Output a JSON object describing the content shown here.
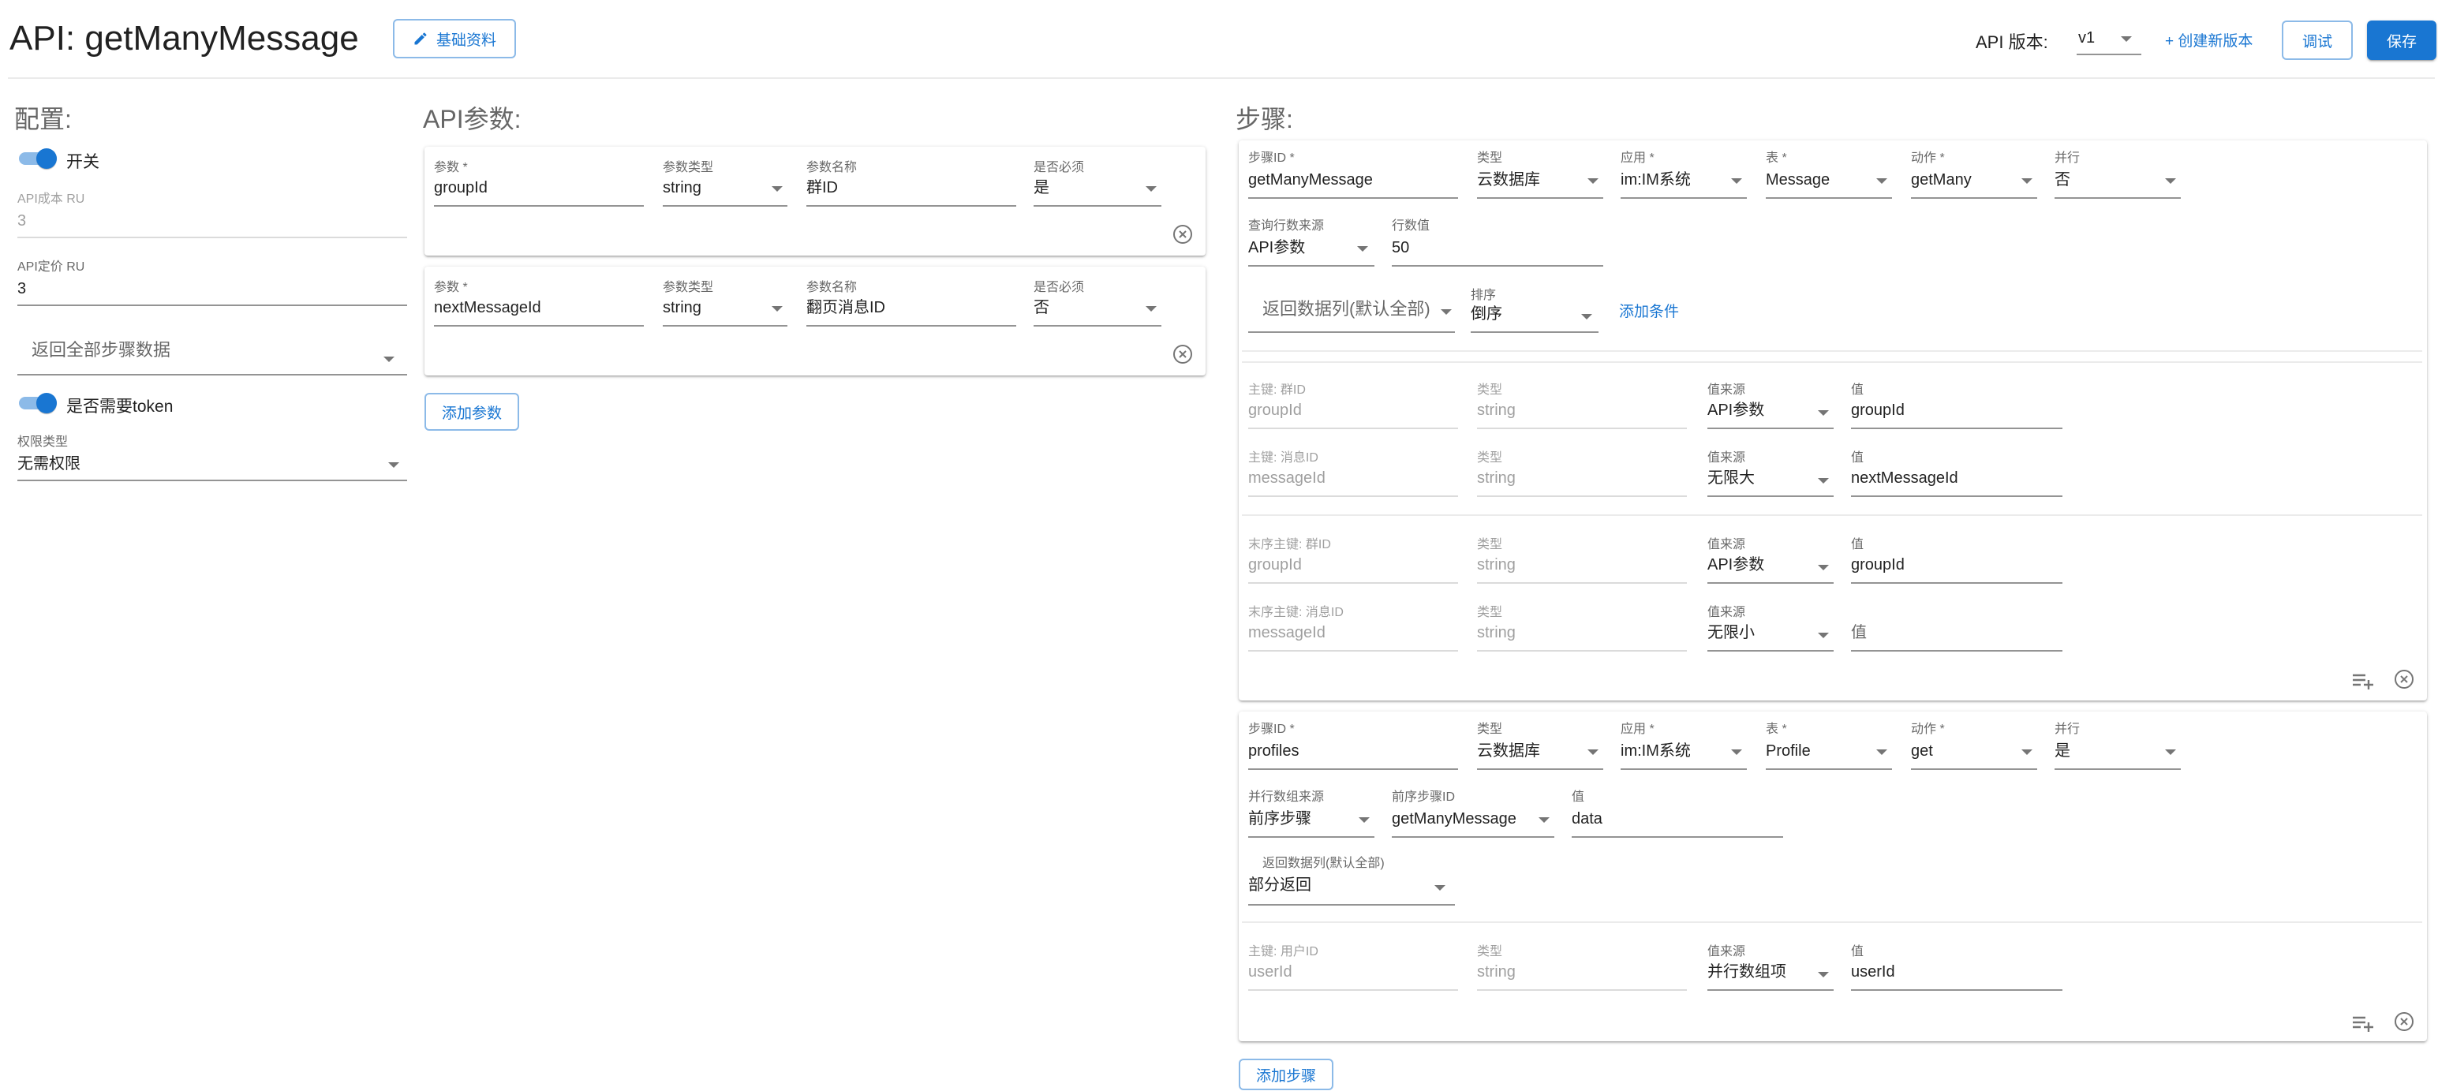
{
  "header": {
    "title": "API: getManyMessage",
    "basic_info_label": "基础资料",
    "version_label": "API 版本:",
    "version_value": "v1",
    "create_version_label": "+ 创建新版本",
    "debug_label": "调试",
    "save_label": "保存"
  },
  "config": {
    "title": "配置:",
    "switch_label": "开关",
    "cost_label": "API成本 RU",
    "cost_value": "3",
    "price_label": "API定价 RU",
    "price_value": "3",
    "return_all_label": "返回全部步骤数据",
    "token_label": "是否需要token",
    "perm_label": "权限类型",
    "perm_value": "无需权限"
  },
  "params": {
    "title": "API参数:",
    "labels": {
      "param": "参数 *",
      "type": "参数类型",
      "name": "参数名称",
      "required": "是否必须"
    },
    "items": [
      {
        "param": "groupId",
        "type": "string",
        "name": "群ID",
        "required": "是"
      },
      {
        "param": "nextMessageId",
        "type": "string",
        "name": "翻页消息ID",
        "required": "否"
      }
    ],
    "add_label": "添加参数"
  },
  "steps": {
    "title": "步骤:",
    "labels": {
      "step_id": "步骤ID *",
      "type": "类型",
      "app": "应用 *",
      "table": "表 *",
      "action": "动作 *",
      "parallel": "并行",
      "value_source": "值来源",
      "value": "值"
    },
    "step1": {
      "step_id": "getManyMessage",
      "type": "云数据库",
      "app": "im:IM系统",
      "table": "Message",
      "action": "getMany",
      "parallel": "否",
      "rows_source_label": "查询行数来源",
      "rows_source": "API参数",
      "rows_value_label": "行数值",
      "rows_value": "50",
      "return_cols": "返回数据列(默认全部)",
      "sort_label": "排序",
      "sort_value": "倒序",
      "add_condition": "添加条件",
      "conditions": [
        {
          "key_label": "主键: 群ID",
          "key": "groupId",
          "type": "string",
          "src": "API参数",
          "val": "groupId",
          "ph": false
        },
        {
          "key_label": "主键: 消息ID",
          "key": "messageId",
          "type": "string",
          "src": "无限大",
          "val": "nextMessageId",
          "ph": false
        },
        {
          "key_label": "末序主键: 群ID",
          "key": "groupId",
          "type": "string",
          "src": "API参数",
          "val": "groupId",
          "ph": false
        },
        {
          "key_label": "末序主键: 消息ID",
          "key": "messageId",
          "type": "string",
          "src": "无限小",
          "val": "值",
          "ph": true
        }
      ]
    },
    "step2": {
      "step_id": "profiles",
      "type": "云数据库",
      "app": "im:IM系统",
      "table": "Profile",
      "action": "get",
      "parallel": "是",
      "par_src_label": "并行数组来源",
      "par_src": "前序步骤",
      "prev_step_label": "前序步骤ID",
      "prev_step": "getManyMessage",
      "val_label": "值",
      "val": "data",
      "return_cols_label": "返回数据列(默认全部)",
      "return_cols": "部分返回",
      "conditions": [
        {
          "key_label": "主键: 用户ID",
          "key": "userId",
          "type": "string",
          "src": "并行数组项",
          "val": "userId",
          "ph": false
        }
      ]
    },
    "add_step_label": "添加步骤"
  },
  "colors": {
    "primary": "#1976d2"
  }
}
